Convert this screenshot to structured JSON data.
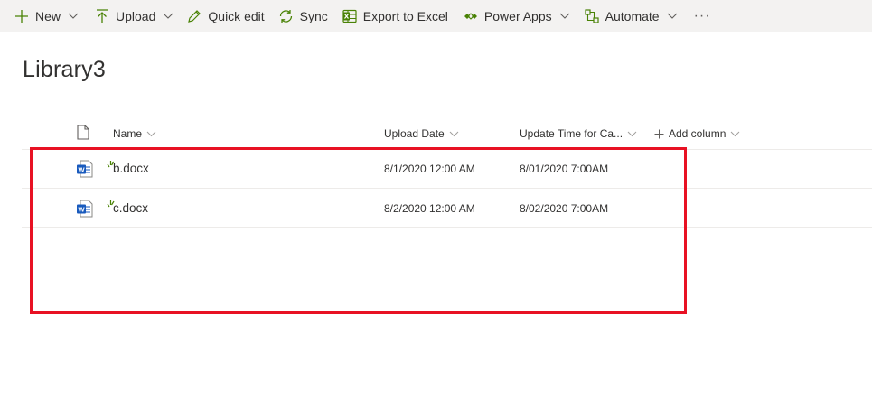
{
  "commandbar": {
    "new": "New",
    "upload": "Upload",
    "quick_edit": "Quick edit",
    "sync": "Sync",
    "export": "Export to Excel",
    "power_apps": "Power Apps",
    "automate": "Automate",
    "more": "···"
  },
  "library": {
    "title": "Library3"
  },
  "columns": {
    "name": "Name",
    "upload_date": "Upload Date",
    "update_time": "Update Time for Ca...",
    "add_column": "Add column"
  },
  "files": [
    {
      "name": "b.docx",
      "upload_date": "8/1/2020 12:00 AM",
      "update_time": "8/01/2020 7:00AM",
      "icon": "word-doc-icon",
      "new_badge": true
    },
    {
      "name": "c.docx",
      "upload_date": "8/2/2020 12:00 AM",
      "update_time": "8/02/2020 7:00AM",
      "icon": "word-doc-icon",
      "new_badge": true
    }
  ],
  "colors": {
    "accent_green": "#498205",
    "word_blue": "#185abd",
    "highlight_red": "#e81123",
    "commandbar_bg": "#f3f2f1"
  }
}
